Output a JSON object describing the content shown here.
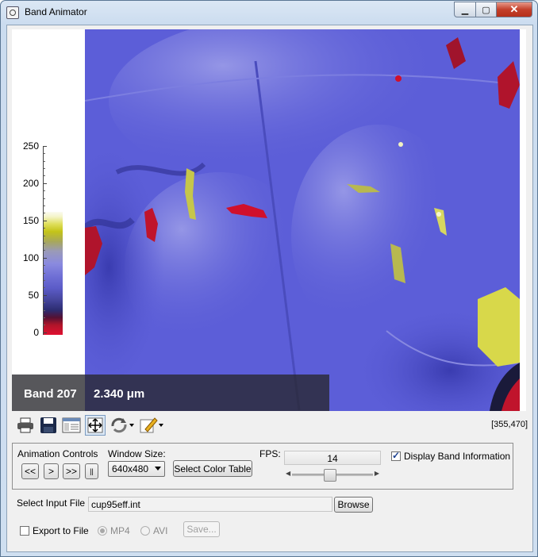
{
  "window": {
    "title": "Band Animator",
    "controls": {
      "minimize": "▁",
      "maximize": "▢",
      "close": "✕"
    }
  },
  "colorbar": {
    "ticks": [
      "250",
      "200",
      "150",
      "100",
      "50",
      "0"
    ]
  },
  "overlay": {
    "band_label": "Band 207",
    "wavelength": "2.340 μm"
  },
  "toolbar": {
    "icons": [
      "printer-icon",
      "save-icon",
      "properties-icon",
      "fit-window-icon",
      "rotate-icon",
      "edit-icon"
    ]
  },
  "status": {
    "coords": "[355,470]"
  },
  "animation": {
    "group_label": "Animation Controls",
    "rewind": "<<",
    "step": ">",
    "fast_forward": ">>",
    "pause": "||"
  },
  "window_size": {
    "label": "Window Size:",
    "value": "640x480"
  },
  "color_table_button": "Select Color Table",
  "fps": {
    "label": "FPS:",
    "value": "14",
    "slider_fraction": 0.45
  },
  "display_band_info": {
    "label": "Display Band Information",
    "checked": true
  },
  "input_file": {
    "label": "Select Input File :",
    "value": "cup95eff.int",
    "browse": "Browse"
  },
  "export": {
    "label": "Export to File",
    "checked": false,
    "mp4": "MP4",
    "avi": "AVI",
    "save": "Save..."
  },
  "colors": {
    "image_base": "#5a5cd6",
    "hot": "#d0102c",
    "highlight": "#d8d84a"
  }
}
